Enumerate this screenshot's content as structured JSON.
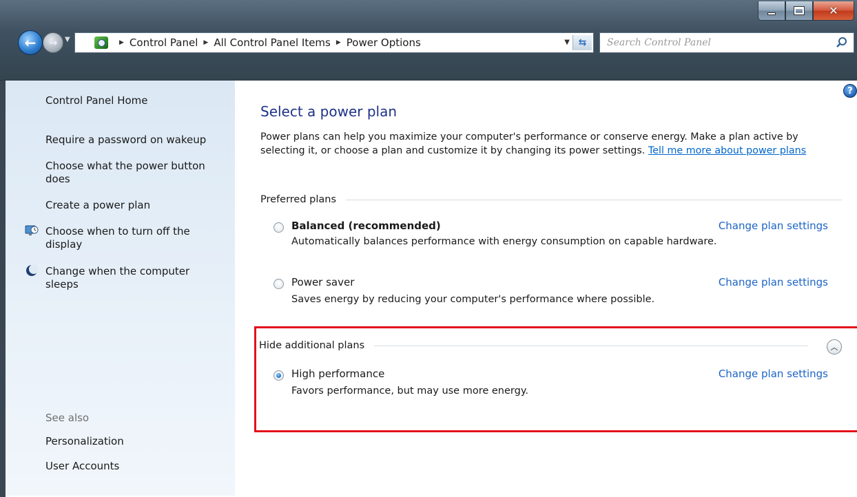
{
  "window": {
    "breadcrumb": [
      "Control Panel",
      "All Control Panel Items",
      "Power Options"
    ],
    "search_placeholder": "Search Control Panel"
  },
  "sidebar": {
    "home": "Control Panel Home",
    "tasks": [
      "Require a password on wakeup",
      "Choose what the power button does",
      "Create a power plan",
      "Choose when to turn off the display",
      "Change when the computer sleeps"
    ],
    "see_also_label": "See also",
    "see_also": [
      "Personalization",
      "User Accounts"
    ]
  },
  "main": {
    "title": "Select a power plan",
    "intro_text": "Power plans can help you maximize your computer's performance or conserve energy. Make a plan active by selecting it, or choose a plan and customize it by changing its power settings.",
    "intro_link": "Tell me more about power plans",
    "preferred_header": "Preferred plans",
    "additional_header": "Hide additional plans",
    "plans": [
      {
        "name": "Balanced (recommended)",
        "description": "Automatically balances performance with energy consumption on capable hardware.",
        "link": "Change plan settings",
        "selected": false
      },
      {
        "name": "Power saver",
        "description": "Saves energy by reducing your computer's performance where possible.",
        "link": "Change plan settings",
        "selected": false
      },
      {
        "name": "High performance",
        "description": "Favors performance, but may use more energy.",
        "link": "Change plan settings",
        "selected": true
      }
    ]
  },
  "colors": {
    "title_blue": "#1e3287",
    "link_blue": "#1c64c6",
    "highlight_red": "#e3101a",
    "sidebar_bg": "#dbe8f4"
  }
}
